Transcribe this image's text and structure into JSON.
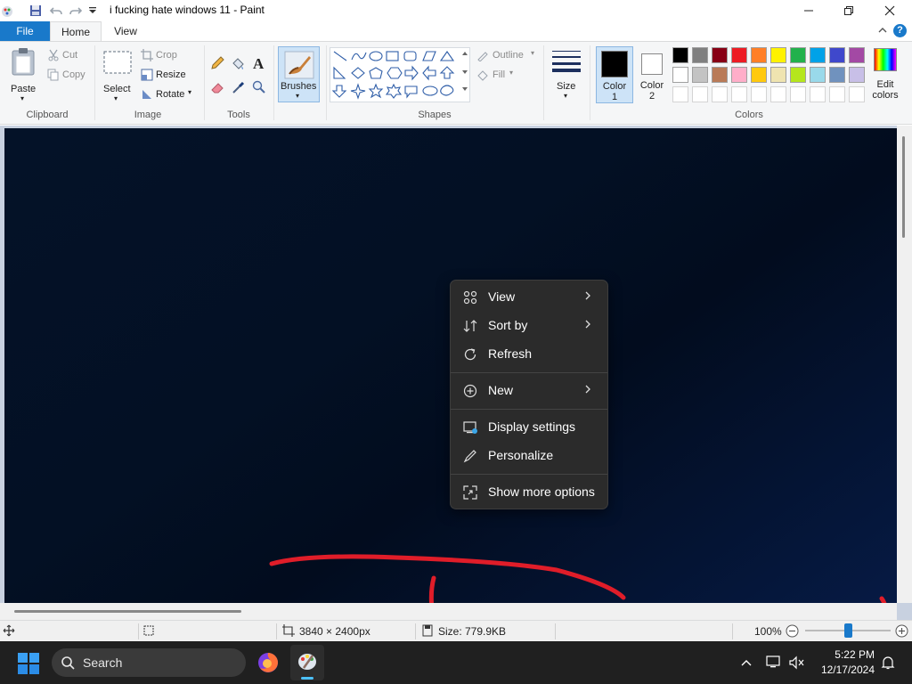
{
  "window": {
    "title": "i fucking hate windows 11 - Paint"
  },
  "tabs": {
    "file": "File",
    "home": "Home",
    "view": "View"
  },
  "clipboard": {
    "paste": "Paste",
    "cut": "Cut",
    "copy": "Copy",
    "group": "Clipboard"
  },
  "image": {
    "select": "Select",
    "crop": "Crop",
    "resize": "Resize",
    "rotate": "Rotate",
    "group": "Image"
  },
  "tools": {
    "group": "Tools"
  },
  "brushes": {
    "label": "Brushes"
  },
  "shapes": {
    "outline": "Outline",
    "fill": "Fill",
    "group": "Shapes"
  },
  "size": {
    "label": "Size"
  },
  "colors": {
    "color1": "Color 1",
    "color1_a": "Color",
    "color1_b": "1",
    "color2_a": "Color",
    "color2_b": "2",
    "edit_a": "Edit",
    "edit_b": "colors",
    "group": "Colors",
    "row1": [
      "#000000",
      "#7f7f7f",
      "#880015",
      "#ed1c24",
      "#ff7f27",
      "#fff200",
      "#22b14c",
      "#00a2e8",
      "#3f48cc",
      "#a349a4"
    ],
    "row2": [
      "#ffffff",
      "#c3c3c3",
      "#b97a57",
      "#ffaec9",
      "#ffc90e",
      "#efe4b0",
      "#b5e61d",
      "#99d9ea",
      "#7092be",
      "#c8bfe7"
    ]
  },
  "context_menu": {
    "view": "View",
    "sort_by": "Sort by",
    "refresh": "Refresh",
    "new": "New",
    "display_settings": "Display settings",
    "personalize": "Personalize",
    "show_more": "Show more options"
  },
  "status": {
    "dimensions": "3840 × 2400px",
    "size": "Size: 779.9KB",
    "zoom": "100%",
    "zoom_value": 100
  },
  "taskbar": {
    "search": "Search",
    "time": "5:22 PM",
    "date": "12/17/2024"
  }
}
